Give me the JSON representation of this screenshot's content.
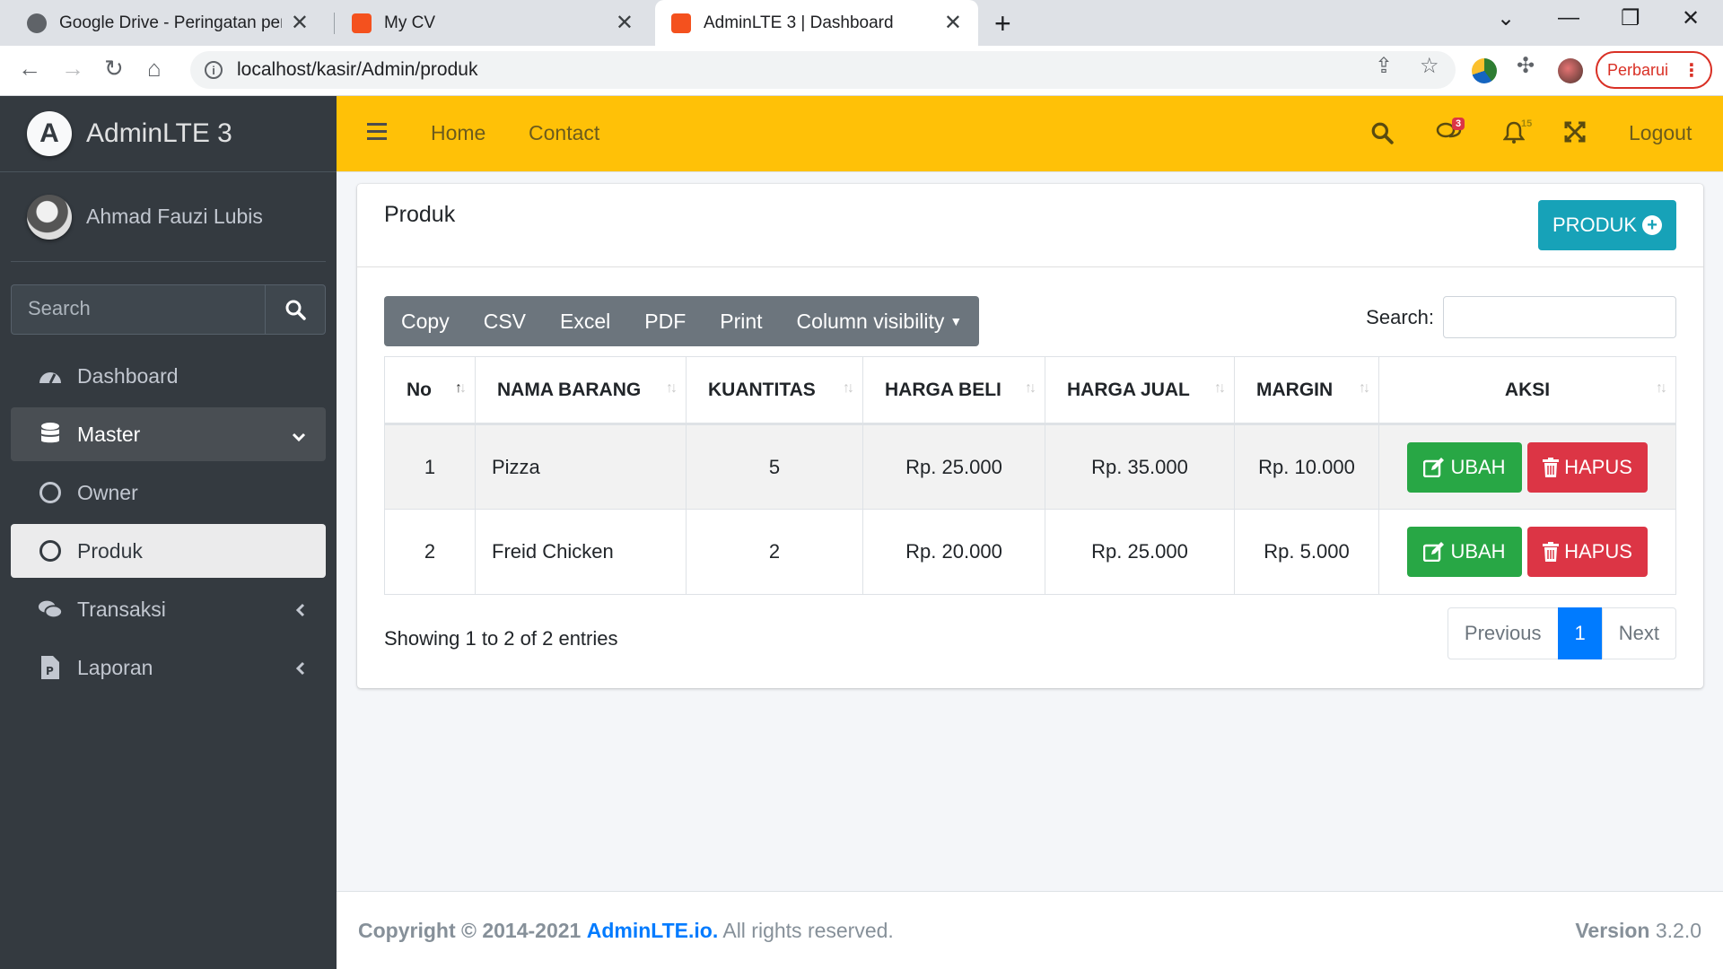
{
  "browser": {
    "tabs": [
      {
        "title": "Google Drive - Peringatan pemin",
        "favicon_color": "#5f6368"
      },
      {
        "title": "My CV",
        "favicon_color": "#f4511e"
      },
      {
        "title": "AdminLTE 3 | Dashboard",
        "favicon_color": "#f4511e"
      }
    ],
    "url": "localhost/kasir/Admin/produk",
    "update_label": "Perbarui"
  },
  "sidebar": {
    "brand": "AdminLTE 3",
    "brand_logo": "A",
    "user_name": "Ahmad Fauzi Lubis",
    "search_placeholder": "Search",
    "items": [
      {
        "label": "Dashboard",
        "icon": "tachometer-icon"
      },
      {
        "label": "Master",
        "icon": "database-icon"
      },
      {
        "label": "Owner",
        "icon": "circle-icon"
      },
      {
        "label": "Produk",
        "icon": "circle-icon"
      },
      {
        "label": "Transaksi",
        "icon": "comments-icon"
      },
      {
        "label": "Laporan",
        "icon": "file-icon"
      }
    ]
  },
  "header": {
    "links": [
      "Home",
      "Contact"
    ],
    "messages_badge": "3",
    "notifications_badge": "15",
    "logout": "Logout",
    "color": "#ffc107"
  },
  "card": {
    "title": "Produk",
    "add_button": "PRODUK"
  },
  "datatable": {
    "buttons": [
      "Copy",
      "CSV",
      "Excel",
      "PDF",
      "Print",
      "Column visibility"
    ],
    "search_label": "Search:",
    "columns": [
      "No",
      "NAMA BARANG",
      "KUANTITAS",
      "HARGA BELI",
      "HARGA JUAL",
      "MARGIN",
      "AKSI"
    ],
    "rows": [
      {
        "no": "1",
        "nama": "Pizza",
        "qty": "5",
        "beli": "Rp. 25.000",
        "jual": "Rp. 35.000",
        "margin": "Rp. 10.000"
      },
      {
        "no": "2",
        "nama": "Freid Chicken",
        "qty": "2",
        "beli": "Rp. 20.000",
        "jual": "Rp. 25.000",
        "margin": "Rp. 5.000"
      }
    ],
    "edit_label": "UBAH",
    "delete_label": "HAPUS",
    "info": "Showing 1 to 2 of 2 entries",
    "pagination": {
      "previous": "Previous",
      "current": "1",
      "next": "Next"
    }
  },
  "footer": {
    "copyright_prefix": "Copyright © 2014-2021",
    "brand_link": "AdminLTE.io.",
    "rights": "All rights reserved.",
    "version_label": "Version",
    "version": "3.2.0"
  }
}
